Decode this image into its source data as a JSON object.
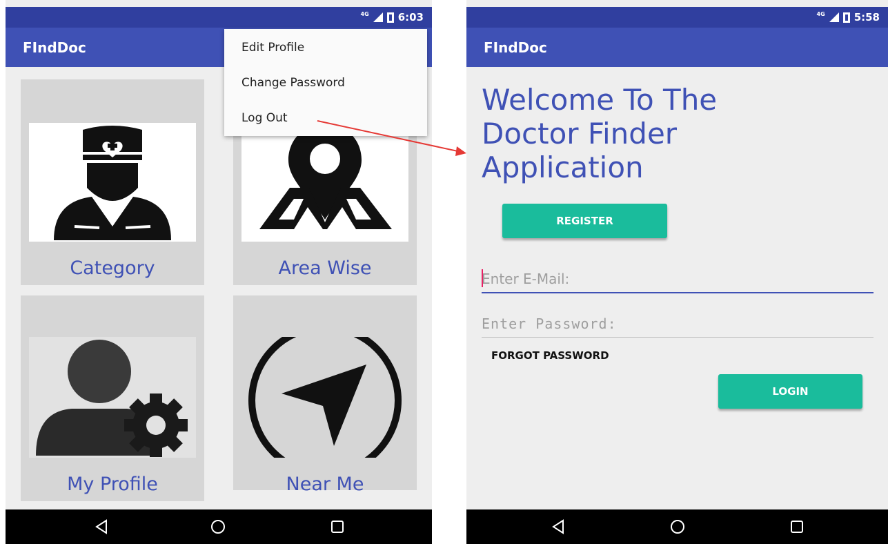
{
  "left_screen": {
    "status_network": "4G",
    "status_time": "6:03",
    "app_title": "FIndDoc",
    "overflow_menu": {
      "items": [
        {
          "label": "Edit Profile"
        },
        {
          "label": "Change Password"
        },
        {
          "label": "Log Out"
        }
      ]
    },
    "tiles": [
      {
        "label": "Category",
        "icon": "doctor-icon"
      },
      {
        "label": "Area Wise",
        "icon": "map-pin-icon"
      },
      {
        "label": "My Profile",
        "icon": "user-settings-icon"
      },
      {
        "label": "Near Me",
        "icon": "navigation-arrow-icon"
      }
    ]
  },
  "right_screen": {
    "status_network": "4G",
    "status_time": "5:58",
    "app_title": "FIndDoc",
    "welcome_lines": [
      "Welcome To The",
      "Doctor Finder",
      "Application"
    ],
    "register_label": "REGISTER",
    "email_placeholder": "Enter E-Mail:",
    "password_placeholder": "Enter Password:",
    "forgot_label": "FORGOT PASSWORD",
    "login_label": "LOGIN"
  },
  "colors": {
    "primary": "#3f51b5",
    "primary_dark": "#303f9f",
    "accent_green": "#1abc9c",
    "arrow": "#e53935"
  }
}
